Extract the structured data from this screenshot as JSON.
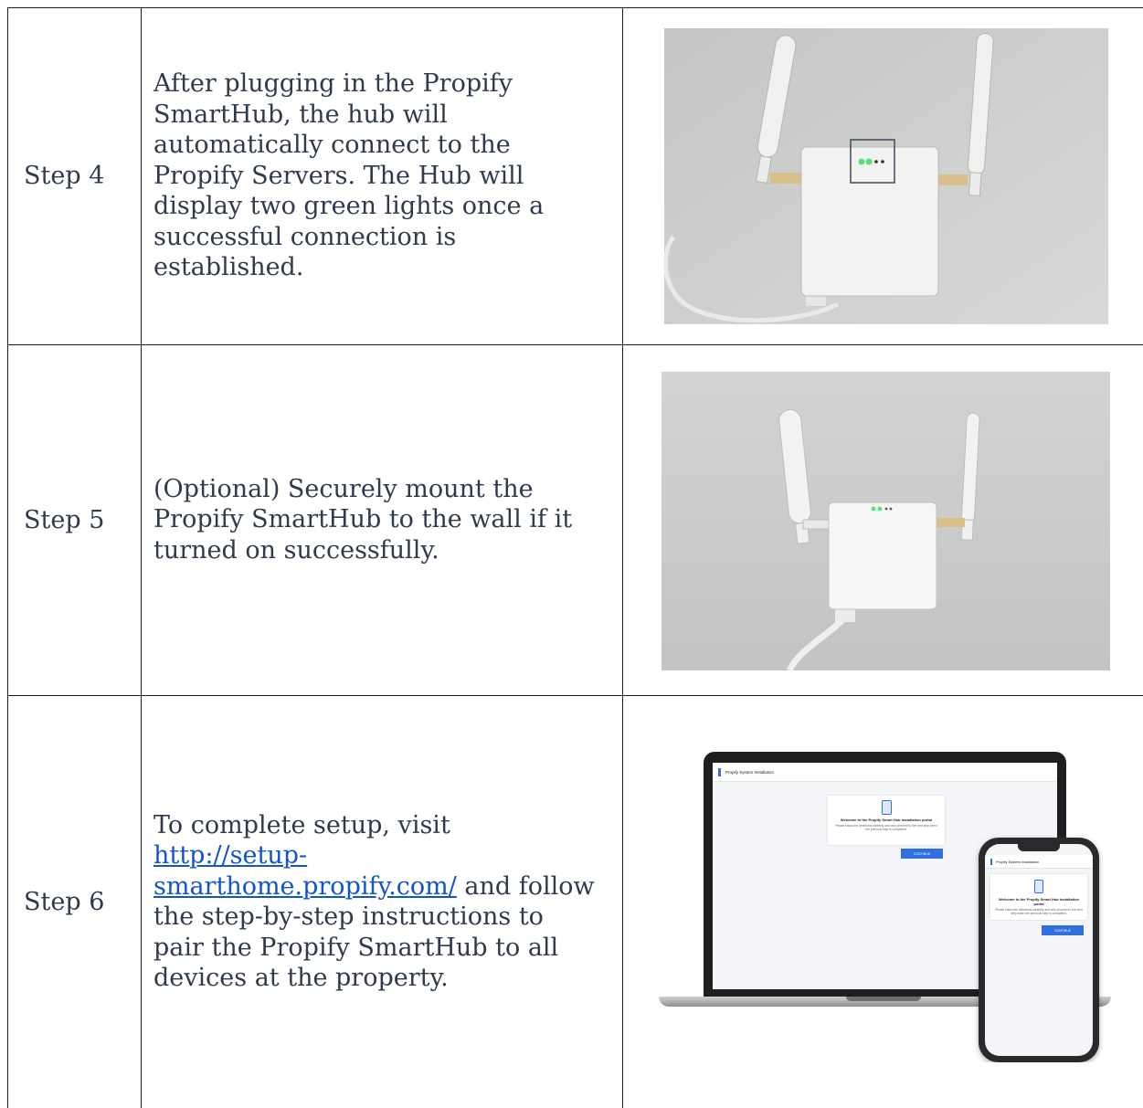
{
  "steps": [
    {
      "label": "Step 4",
      "text": "After plugging in the Propify SmartHub, the hub will automatically connect to the Propify Servers. The Hub will display two green lights once a successful connection is established.",
      "image": "smarthub-lights-photo"
    },
    {
      "label": "Step 5",
      "text": "(Optional) Securely mount the Propify SmartHub to the wall if it turned on successfully.",
      "image": "smarthub-mounted-photo"
    },
    {
      "label": "Step 6",
      "text_before": "To complete setup, visit ",
      "link": "http://setup-smarthome.propify.com/",
      "text_after": " and follow the step-by-step instructions to pair the Propify SmartHub to all devices at the property.",
      "image": "setup-portal-devices-image"
    }
  ],
  "portal": {
    "header": "Propify System Installation",
    "welcome": "Welcome to the Propify Smart Hub installation portal",
    "instructions": "Please follow the directions carefully and only proceed to the next step when the previous step is completed.",
    "button": "CONTINUE"
  },
  "colors": {
    "led_green": "#58e07a",
    "link": "#1155cc",
    "button_blue": "#2f6fe0"
  }
}
